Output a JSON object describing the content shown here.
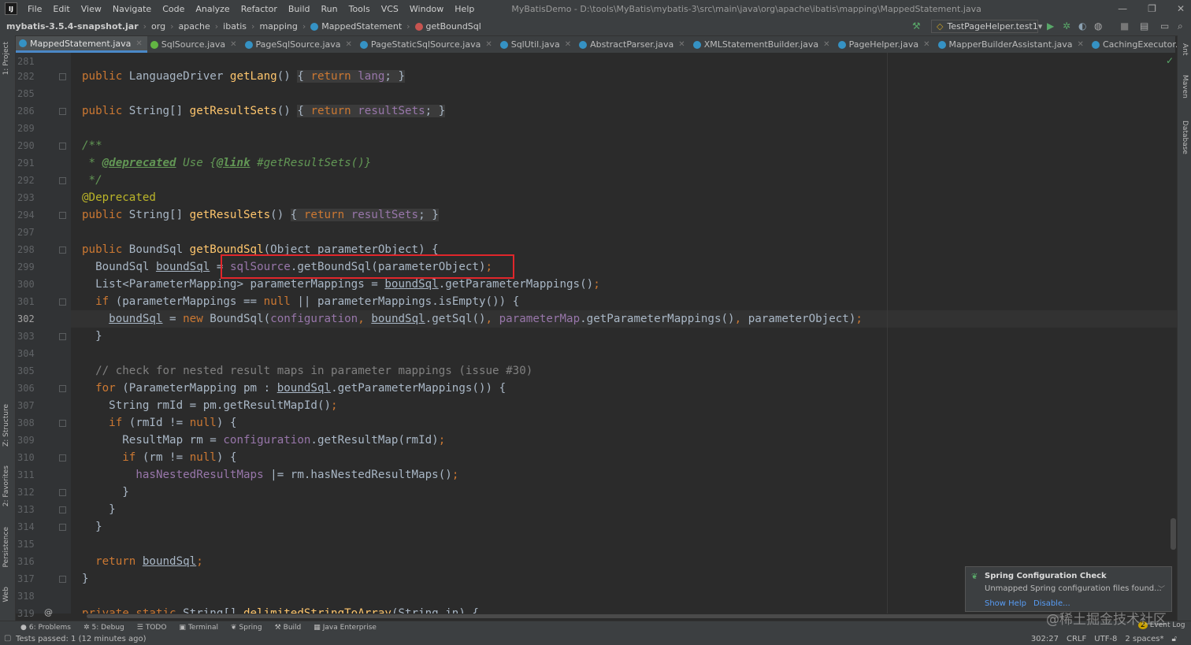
{
  "menubar": {
    "items": [
      "File",
      "Edit",
      "View",
      "Navigate",
      "Code",
      "Analyze",
      "Refactor",
      "Build",
      "Run",
      "Tools",
      "VCS",
      "Window",
      "Help"
    ],
    "window_title": "MyBatisDemo - D:\\tools\\MyBatis\\mybatis-3\\src\\main\\java\\org\\apache\\ibatis\\mapping\\MappedStatement.java",
    "win_min": "—",
    "win_max": "❐",
    "win_close": "✕"
  },
  "navbar": {
    "crumbs": [
      "mybatis-3.5.4-snapshot.jar",
      "org",
      "apache",
      "ibatis",
      "mapping",
      "MappedStatement",
      "getBoundSql"
    ],
    "run_config": "TestPageHelper.test1"
  },
  "tabs": [
    {
      "label": "MappedStatement.java",
      "icon_color": "#3592c4"
    },
    {
      "label": "SqlSource.java",
      "icon_color": "#62b543"
    },
    {
      "label": "PageSqlSource.java",
      "icon_color": "#3592c4"
    },
    {
      "label": "PageStaticSqlSource.java",
      "icon_color": "#3592c4"
    },
    {
      "label": "SqlUtil.java",
      "icon_color": "#3592c4"
    },
    {
      "label": "AbstractParser.java",
      "icon_color": "#3592c4"
    },
    {
      "label": "XMLStatementBuilder.java",
      "icon_color": "#3592c4"
    },
    {
      "label": "PageHelper.java",
      "icon_color": "#3592c4"
    },
    {
      "label": "MapperBuilderAssistant.java",
      "icon_color": "#3592c4"
    },
    {
      "label": "CachingExecutor.java",
      "icon_color": "#3592c4"
    }
  ],
  "left_strip": [
    "1: Project",
    "Z: Structure",
    "2: Favorites",
    "Persistence",
    "Web"
  ],
  "right_strip": [
    "Ant",
    "Maven",
    "Database"
  ],
  "editor": {
    "line_numbers": [
      "281",
      "282",
      "285",
      "286",
      "289",
      "290",
      "291",
      "292",
      "293",
      "294",
      "297",
      "298",
      "299",
      "300",
      "301",
      "302",
      "303",
      "304",
      "305",
      "306",
      "307",
      "308",
      "309",
      "310",
      "311",
      "312",
      "313",
      "314",
      "315",
      "316",
      "317",
      "318",
      "319"
    ],
    "current_line": "302"
  },
  "notification": {
    "title": "Spring Configuration Check",
    "body": "Unmapped Spring configuration files found...",
    "link_help": "Show Help",
    "link_disable": "Disable..."
  },
  "bottom_tabs": [
    "6: Problems",
    "5: Debug",
    "TODO",
    "Terminal",
    "Spring",
    "Build",
    "Java Enterprise"
  ],
  "status": {
    "message": "Tests passed: 1 (12 minutes ago)",
    "position": "302:27",
    "line_sep": "CRLF",
    "encoding": "UTF-8",
    "indent": "2 spaces*",
    "event_log": "Event Log",
    "event_count": "2"
  },
  "watermark": "@稀土掘金技术社区",
  "colors": {
    "accent": "#4a88c7",
    "highlight_box": "#e0262b",
    "keyword": "#cc7832",
    "method": "#ffc66d",
    "field": "#9876aa"
  }
}
